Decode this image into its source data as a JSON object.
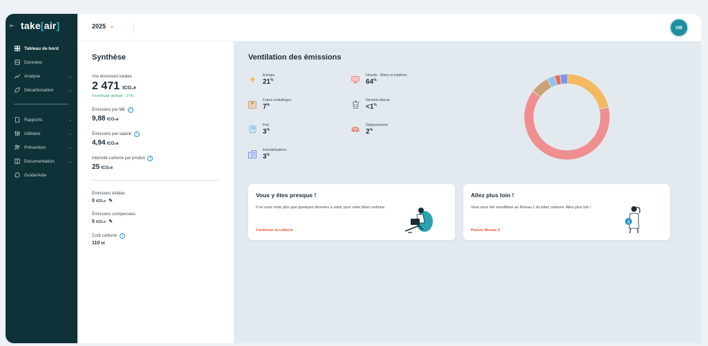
{
  "app": {
    "logo_text": "take",
    "logo_bracket_open": "[",
    "logo_bracket_word": "air",
    "logo_bracket_close": "]"
  },
  "sidebar": {
    "collapse_icon": "collapse-left-icon",
    "items": [
      {
        "label": "Tableau de bord",
        "icon": "dashboard-icon",
        "active": true,
        "chevron": false
      },
      {
        "label": "Données",
        "icon": "database-icon",
        "active": false,
        "chevron": false
      },
      {
        "label": "Analyse",
        "icon": "chart-line-icon",
        "active": false,
        "chevron": true
      },
      {
        "label": "Décarbonation",
        "icon": "leaf-icon",
        "active": false,
        "chevron": true
      },
      {
        "label": "Rapports",
        "icon": "document-icon",
        "active": false,
        "chevron": true
      },
      {
        "label": "Utilitaire",
        "icon": "sliders-icon",
        "active": false,
        "chevron": true
      },
      {
        "label": "Prévention",
        "icon": "users-icon",
        "active": false,
        "chevron": true
      },
      {
        "label": "Documentation",
        "icon": "book-icon",
        "active": false,
        "chevron": true
      },
      {
        "label": "Guide/Aide",
        "icon": "help-chat-icon",
        "active": false,
        "chevron": false
      }
    ]
  },
  "header": {
    "year": "2025",
    "avatar_initials": "OB"
  },
  "synthese": {
    "title": "Synthèse",
    "total_label": "Vos émissions totales",
    "total_value": "2 471",
    "total_unit": "tCO₂e",
    "uncertainty": "Incertitude globale : 17%",
    "per_meur_label": "Émissions par M€",
    "per_meur_value": "9,88",
    "per_meur_unit": "tCO₂e",
    "per_employee_label": "Émissions par salarié",
    "per_employee_value": "4,94",
    "per_employee_unit": "tCO₂e",
    "per_product_label": "Intensité carbone par produit",
    "per_product_value": "25",
    "per_product_unit": "tCO₂e",
    "avoided_label": "Émissions évitées",
    "avoided_value": "0",
    "avoided_unit": "tCO₂e",
    "offset_label": "Émissions compensées",
    "offset_value": "0",
    "offset_unit": "tCO₂e",
    "carbon_cost_label": "Coût carbone",
    "carbon_cost_value": "110",
    "carbon_cost_unit": "k€"
  },
  "ventilation": {
    "title": "Ventilation des émissions",
    "categories": [
      {
        "name": "Energie",
        "value": "21",
        "pct": "%",
        "icon": "energy-icon",
        "color": "#f4b860"
      },
      {
        "name": "Intrants - Biens et matières",
        "value": "64",
        "pct": "%",
        "icon": "monitor-icon",
        "color": "#ef8f8f"
      },
      {
        "name": "Futurs emballages",
        "value": "7",
        "pct": "%",
        "icon": "package-icon",
        "color": "#c9a27a"
      },
      {
        "name": "Déchets directs",
        "value": "<1",
        "pct": "%",
        "icon": "trash-icon",
        "color": "#7d8a95"
      },
      {
        "name": "Fret",
        "value": "3",
        "pct": "%",
        "icon": "freight-icon",
        "color": "#8ec5ea"
      },
      {
        "name": "Déplacements",
        "value": "2",
        "pct": "%",
        "icon": "car-icon",
        "color": "#e86a5a"
      },
      {
        "name": "Immobilisations",
        "value": "3",
        "pct": "%",
        "icon": "building-icon",
        "color": "#7f97e6"
      }
    ]
  },
  "chart_data": {
    "type": "pie",
    "donut": true,
    "categories": [
      "Energie",
      "Intrants - Biens et matières",
      "Futurs emballages",
      "Déchets directs",
      "Fret",
      "Déplacements",
      "Immobilisations"
    ],
    "values": [
      21,
      64,
      7,
      0.5,
      3,
      2,
      3
    ],
    "colors": [
      "#f4b860",
      "#ef8f8f",
      "#c9a27a",
      "#7d8a95",
      "#8ec5ea",
      "#e86a5a",
      "#7f97e6"
    ],
    "order_clockwise_from_top": [
      "Energie",
      "Intrants - Biens et matières",
      "Futurs emballages",
      "Fret",
      "Déplacements",
      "Immobilisations"
    ]
  },
  "cards": [
    {
      "title": "Vous y êtes presque !",
      "text": "Il ne vous reste plus que quelques données à saisir pour votre bilan carbone.",
      "link": "Continuer la collecte",
      "illustration": "person-laptop-illustration"
    },
    {
      "title": "Allez plus loin !",
      "text": "Vous avez été sensibilisé au Niveau 1 du bilan carbone. Allez plus loin !",
      "link": "Passer Niveau 2",
      "illustration": "person-coin-illustration"
    }
  ]
}
